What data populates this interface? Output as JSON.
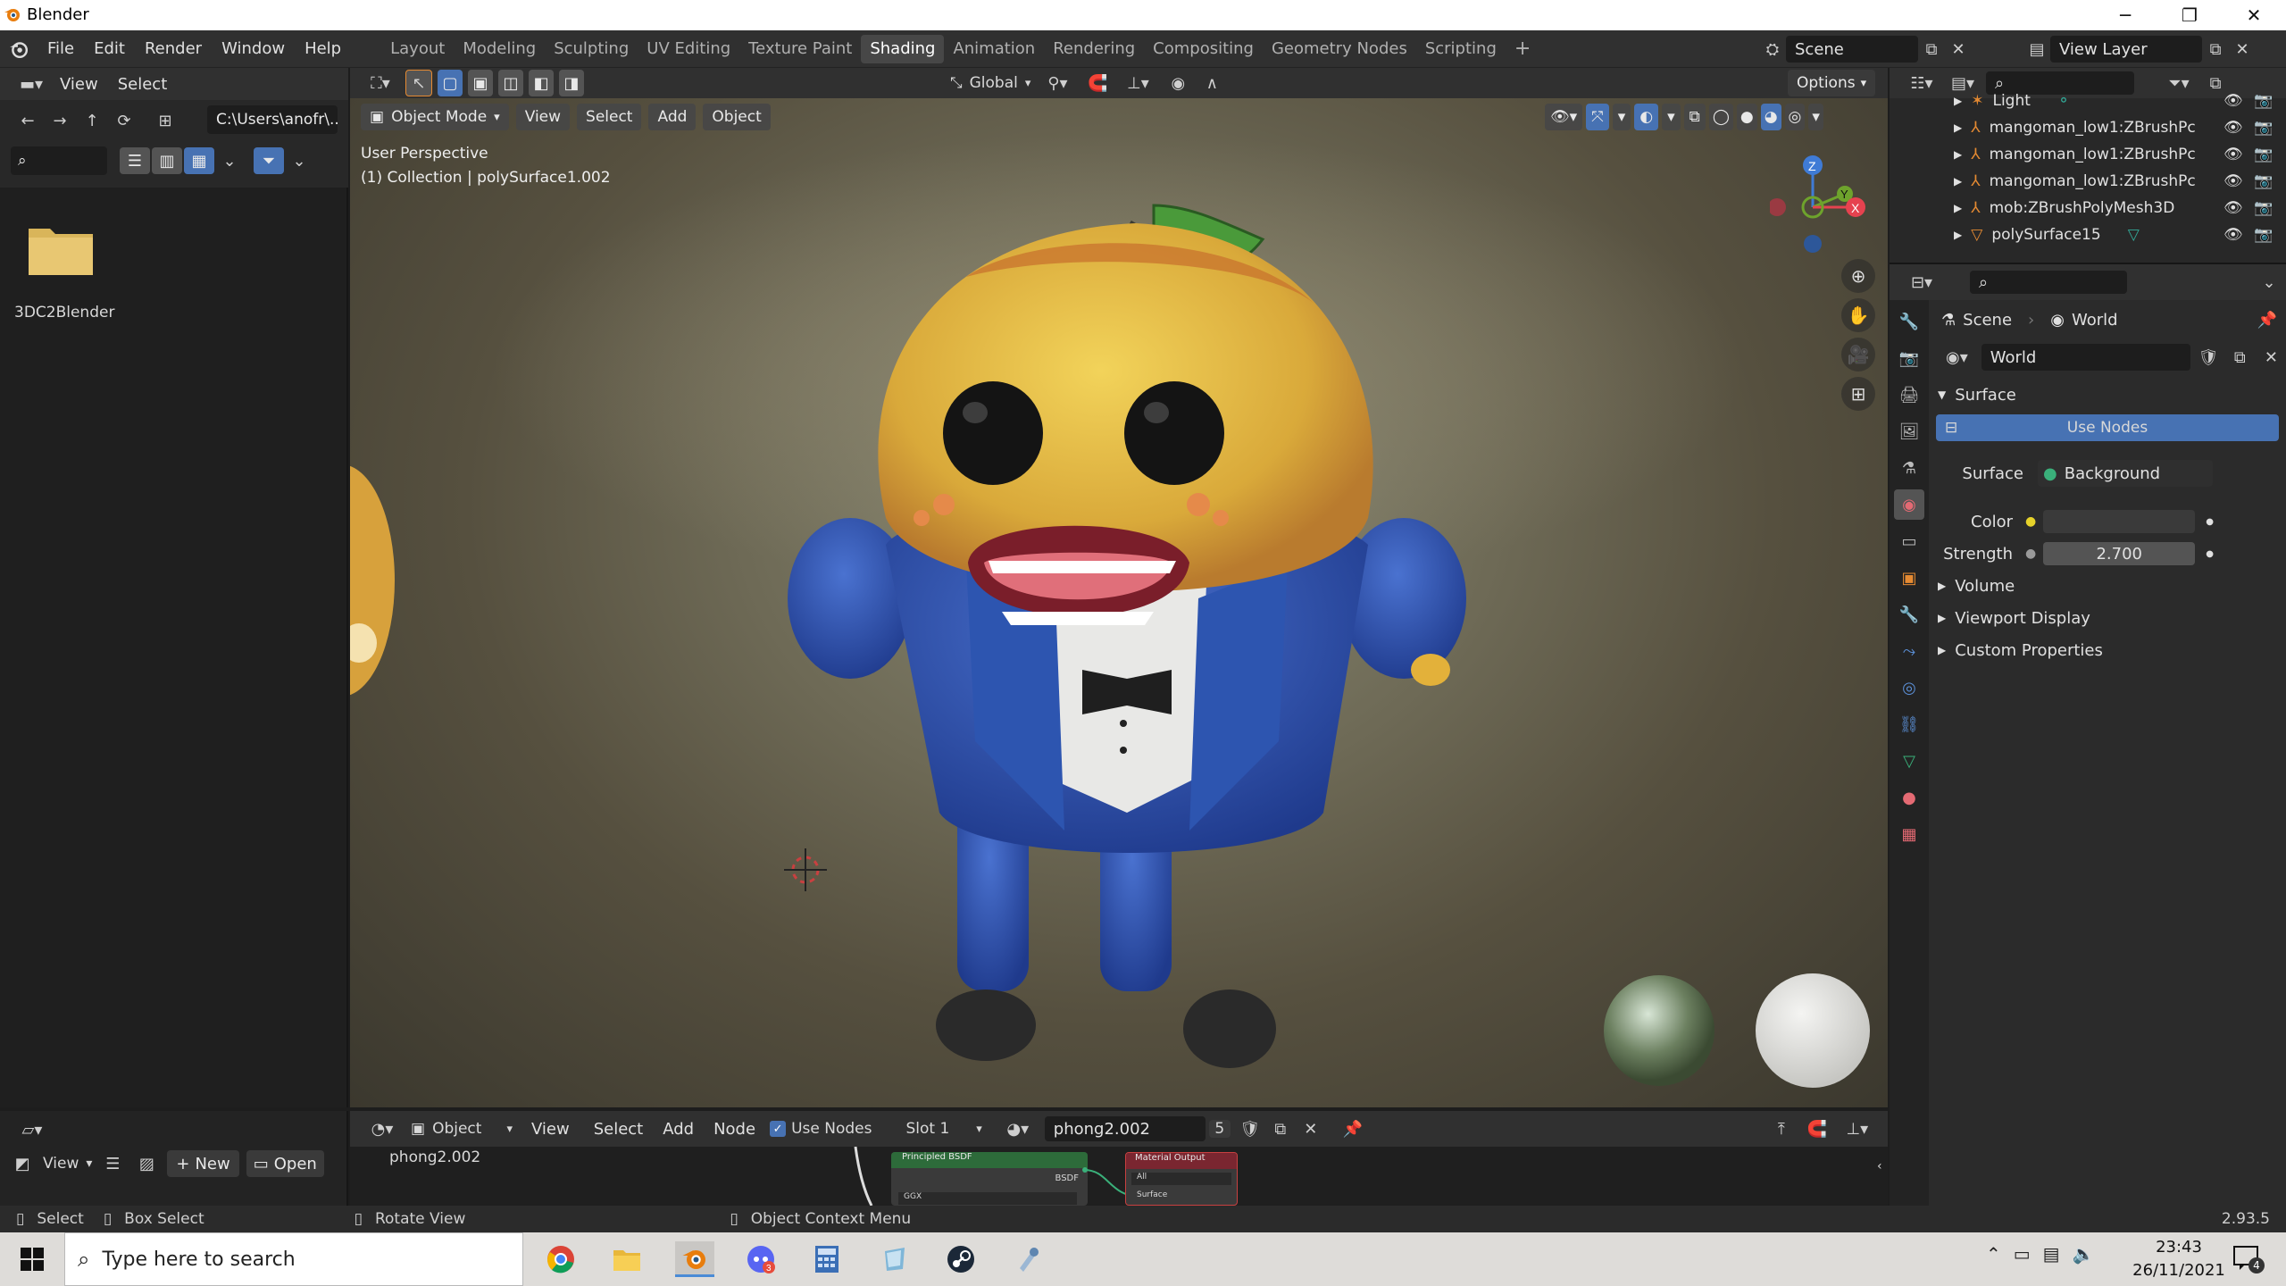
{
  "window": {
    "title": "Blender"
  },
  "menu": [
    "File",
    "Edit",
    "Render",
    "Window",
    "Help"
  ],
  "workspaces": [
    "Layout",
    "Modeling",
    "Sculpting",
    "UV Editing",
    "Texture Paint",
    "Shading",
    "Animation",
    "Rendering",
    "Compositing",
    "Geometry Nodes",
    "Scripting"
  ],
  "active_workspace": "Shading",
  "scene": {
    "name": "Scene",
    "view_layer": "View Layer"
  },
  "file_browser": {
    "menu": [
      "View",
      "Select"
    ],
    "path": "C:\\Users\\anofr\\...",
    "folder": "3DC2Blender"
  },
  "viewport": {
    "mode": "Object Mode",
    "menu": [
      "View",
      "Select",
      "Add",
      "Object"
    ],
    "transform": "Global",
    "perspective": "User Perspective",
    "collection": "(1) Collection | polySurface1.002",
    "options": "Options"
  },
  "outliner": {
    "items": [
      "Light",
      "mangoman_low1:ZBrushPc",
      "mangoman_low1:ZBrushPc",
      "mangoman_low1:ZBrushPc",
      "mob:ZBrushPolyMesh3D",
      "polySurface15"
    ]
  },
  "properties": {
    "breadcrumb_scene": "Scene",
    "breadcrumb_world": "World",
    "world_name": "World",
    "surface_panel": "Surface",
    "use_nodes": "Use Nodes",
    "surface_label": "Surface",
    "surface_value": "Background",
    "color_label": "Color",
    "strength_label": "Strength",
    "strength_value": "2.700",
    "subpanels": [
      "Volume",
      "Viewport Display",
      "Custom Properties"
    ]
  },
  "node_editor": {
    "object": "Object",
    "menu": [
      "View",
      "Select",
      "Add",
      "Node"
    ],
    "use_nodes": "Use Nodes",
    "slot": "Slot 1",
    "material": "phong2.002",
    "users": "5",
    "material_label": "phong2.002",
    "node1": "Principled BSDF",
    "node1_out": "BSDF",
    "node1_sub": "GGX",
    "node2": "Material Output",
    "node2_sel": "All",
    "node2_in": "Surface"
  },
  "left_bottom": {
    "view": "View",
    "new": "New",
    "open": "Open"
  },
  "statusbar": {
    "select": "Select",
    "box_select": "Box Select",
    "rotate": "Rotate View",
    "context": "Object Context Menu",
    "version": "2.93.5"
  },
  "taskbar": {
    "search_placeholder": "Type here to search",
    "time": "23:43",
    "date": "26/11/2021",
    "notifications": "4"
  },
  "colors": {
    "accent_blue": "#4772b3",
    "active_tab": "#474747",
    "title_bar": "#ffffff",
    "x_axis": "#e6424f",
    "y_axis": "#6ea32c",
    "z_axis": "#3f7bd6"
  }
}
